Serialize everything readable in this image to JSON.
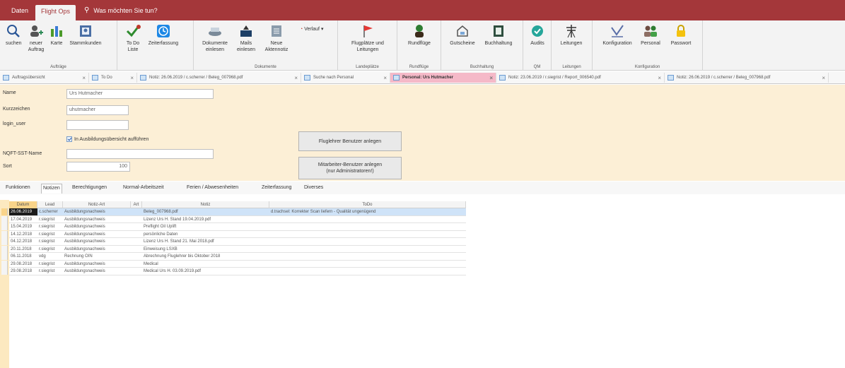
{
  "menu": {
    "tabs": [
      "Daten",
      "Flight Ops"
    ],
    "active_tab": "Flight Ops",
    "tell_me": "Was möchten Sie tun?"
  },
  "ribbon": {
    "groups": [
      {
        "label": "Aufträge",
        "buttons": [
          "suchen",
          "neuer Auftrag",
          "Karte",
          "Stammkunden"
        ]
      },
      {
        "label": "",
        "buttons": [
          "To Do Liste",
          "Zeiterfassung"
        ]
      },
      {
        "label": "Dokumente",
        "buttons": [
          "Dokumente einlesen",
          "Mails einlesen",
          "Neue Aktennotiz",
          "Verlauf"
        ]
      },
      {
        "label": "Landeplätze",
        "buttons": [
          "Flugplätze und Leitungen"
        ]
      },
      {
        "label": "Rundflüge",
        "buttons": [
          "Rundflüge"
        ]
      },
      {
        "label": "Buchhaltung",
        "buttons": [
          "Gutscheine",
          "Buchhaltung"
        ]
      },
      {
        "label": "QM",
        "buttons": [
          "Audits"
        ]
      },
      {
        "label": "Leitungen",
        "buttons": [
          "Leitungen"
        ]
      },
      {
        "label": "Konfiguration",
        "buttons": [
          "Konfiguration",
          "Personal",
          "Passwort"
        ]
      }
    ]
  },
  "doc_tabs": [
    "Auftragsübersicht",
    "To Do",
    "Notiz: 26.06.2019 / c.scherrer / Beleg_007968.pdf",
    "Suche nach Personal",
    "Personal: Urs Hutmacher",
    "Notiz: 23.06.2019 / r.siegrist / Report_006540.pdf",
    "Notiz: 26.06.2019 / c.scherrer / Beleg_007968.pdf"
  ],
  "active_doc_tab": "Personal: Urs Hutmacher",
  "form": {
    "name_label": "Name",
    "name_value": "Urs Hutmacher",
    "kurz_label": "Kurzzeichen",
    "kurz_value": "uhutmacher",
    "login_label": "login_user",
    "login_value": "",
    "checkbox_label": "In Ausbildungsübersicht aufführen",
    "nqft_label": "NQFT-SST-Name",
    "nqft_value": "",
    "sort_label": "Sort",
    "sort_value": "100",
    "btn_fluglehrer": "Fluglehrer Benutzer anlegen",
    "btn_mitarbeiter_line1": "Mitarbeiter-Benutzer anlegen",
    "btn_mitarbeiter_line2": "(nur Administratoren!)"
  },
  "sub_tabs": [
    "Funktionen",
    "Notizen",
    "Berechtigungen",
    "Normal-Arbeitszeit",
    "Ferien / Abwesenheiten",
    "Zeiterfassung",
    "Diverses"
  ],
  "active_sub_tab": "Notizen",
  "table": {
    "columns": [
      "Datum",
      "Lead",
      "Notiz-Art",
      "Art",
      "Notiz",
      "ToDo"
    ],
    "rows": [
      [
        "26.06.2019",
        "c.scherrer",
        "Ausbildungsnachweis",
        "",
        "Beleg_007968.pdf",
        "d.trachsel: Korrekter Scan liefern - Qualität ungenügend"
      ],
      [
        "17.04.2019",
        "r.siegrist",
        "Ausbildungsnachweis",
        "",
        "Lizenz Urs H. Stand 19.04.2019.pdf",
        ""
      ],
      [
        "15.04.2019",
        "r.siegrist",
        "Ausbildungsnachweis",
        "",
        "Preflight Oil Uplift",
        ""
      ],
      [
        "14.12.2018",
        "r.siegrist",
        "Ausbildungsnachweis",
        "",
        "persönliche Daten",
        ""
      ],
      [
        "04.12.2018",
        "r.siegrist",
        "Ausbildungsnachweis",
        "",
        "Lizenz Urs H. Stand 21. Mai 2018.pdf",
        ""
      ],
      [
        "20.11.2018",
        "r.siegrist",
        "Ausbildungsnachweis",
        "",
        "Einweisung LSXB",
        ""
      ],
      [
        "06.11.2018",
        "vdg",
        "Rechnung OIN",
        "",
        "Abrechnung Fluglehrer bis Oktober 2018",
        ""
      ],
      [
        "29.08.2018",
        "r.siegrist",
        "Ausbildungsnachweis",
        "",
        "Medical",
        ""
      ],
      [
        "29.08.2018",
        "r.siegrist",
        "Ausbildungsnachweis",
        "",
        "Medical Urs H. 03.09.2019.pdf",
        ""
      ]
    ]
  },
  "colors": {
    "title_bar": "#a4373a",
    "form_bg": "#fcefd6",
    "active_tab": "#f5b9c8",
    "selected_row": "#cfe3f8",
    "sort_header": "#f9d48a"
  }
}
